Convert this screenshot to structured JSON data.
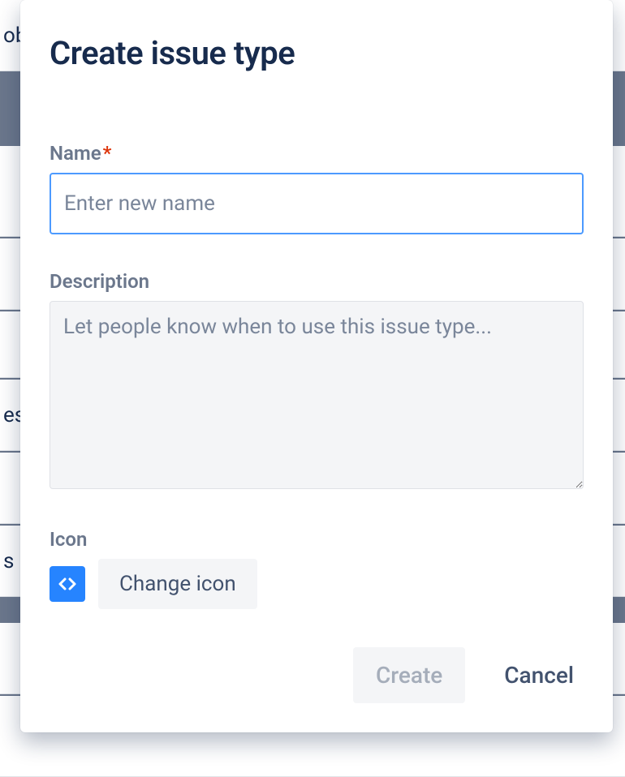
{
  "background": {
    "row1": "ob",
    "row2": "es",
    "row3": "s"
  },
  "modal": {
    "title": "Create issue type",
    "fields": {
      "name": {
        "label": "Name",
        "required": "*",
        "placeholder": "Enter new name",
        "value": ""
      },
      "description": {
        "label": "Description",
        "placeholder": "Let people know when to use this issue type...",
        "value": ""
      },
      "icon": {
        "label": "Icon",
        "change_button": "Change icon"
      }
    },
    "footer": {
      "create": "Create",
      "cancel": "Cancel"
    }
  }
}
